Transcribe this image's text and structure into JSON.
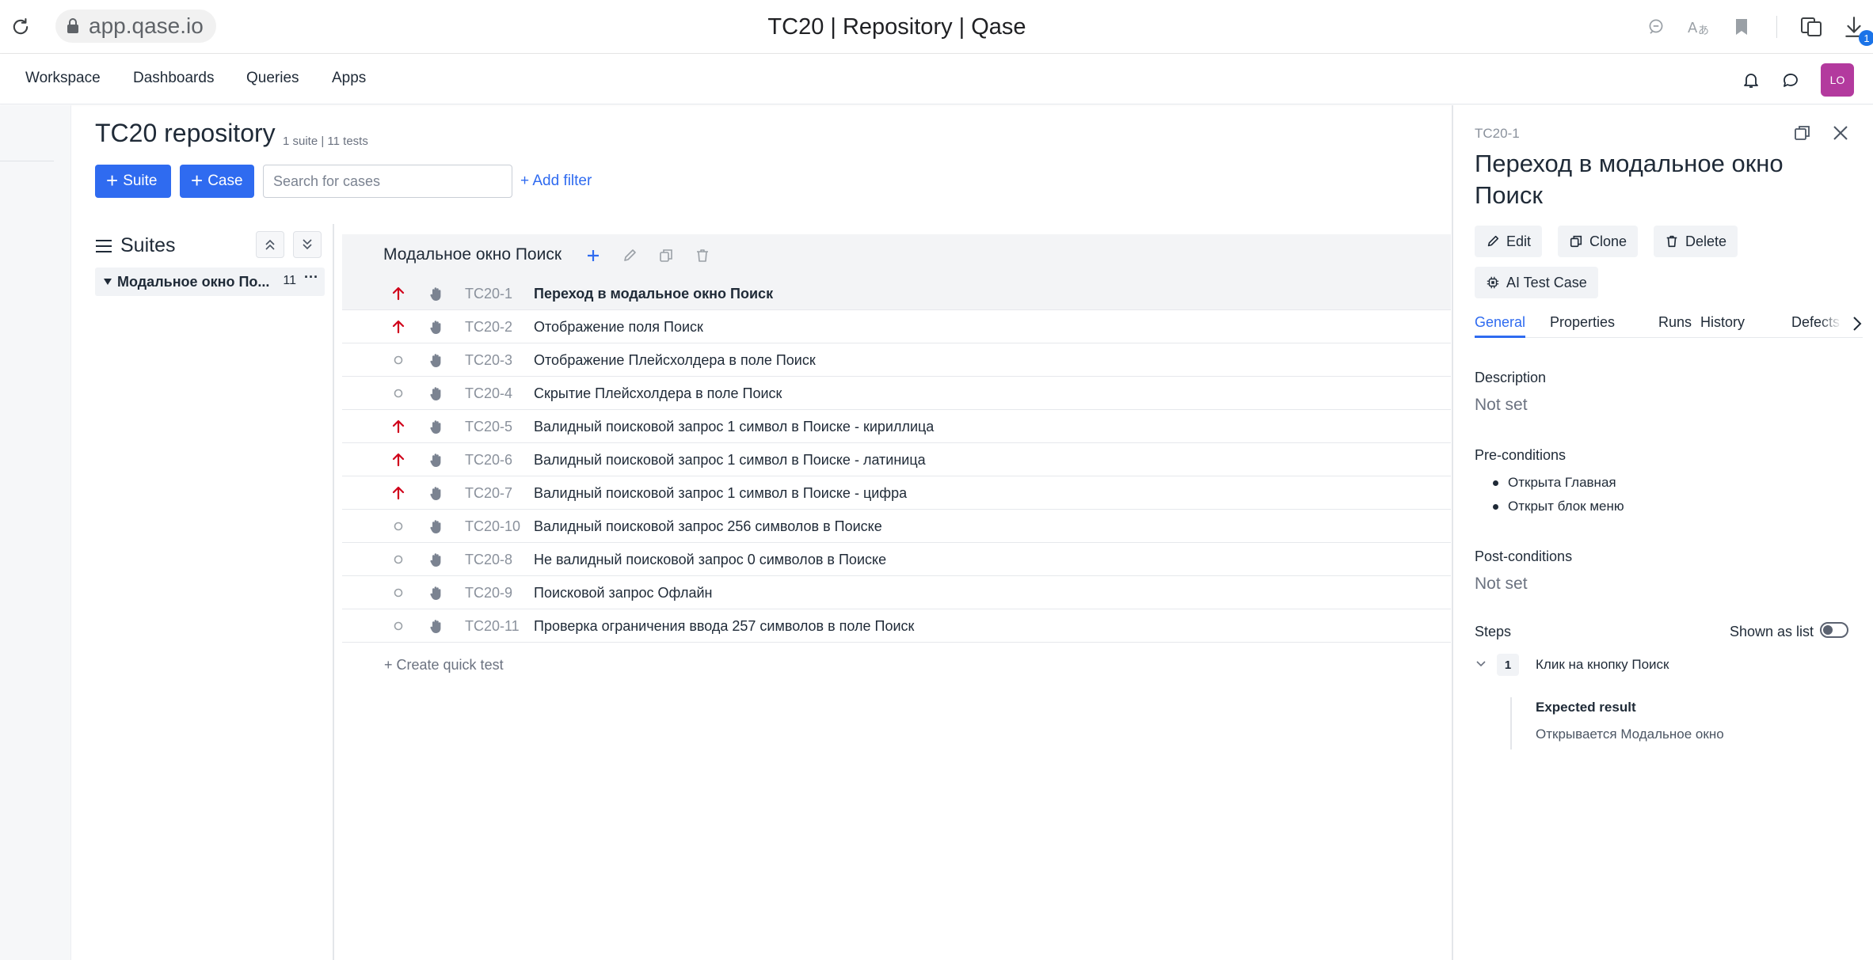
{
  "browser": {
    "url": "app.qase.io",
    "tab_title": "TC20 | Repository | Qase",
    "download_badge": "1"
  },
  "nav": {
    "items": [
      {
        "label": "Workspace"
      },
      {
        "label": "Dashboards"
      },
      {
        "label": "Queries"
      },
      {
        "label": "Apps"
      }
    ],
    "avatar_initials": "LO"
  },
  "header": {
    "title": "TC20 repository",
    "meta": "1 suite | 11 tests",
    "suite_button": "Suite",
    "case_button": "Case",
    "search_placeholder": "Search for cases",
    "add_filter": "+ Add filter"
  },
  "suites": {
    "title": "Suites",
    "items": [
      {
        "label": "Модальное окно По...",
        "count": "11",
        "more": "···"
      }
    ]
  },
  "suite_block": {
    "title": "Модальное окно Поиск"
  },
  "cases": [
    {
      "id": "TC20-1",
      "title": "Переход в модальное окно Поиск",
      "priority": "high",
      "selected": true
    },
    {
      "id": "TC20-2",
      "title": "Отображение поля Поиск",
      "priority": "high"
    },
    {
      "id": "TC20-3",
      "title": "Отображение Плейсхолдера в поле Поиск",
      "priority": "none"
    },
    {
      "id": "TC20-4",
      "title": "Скрытие Плейсхолдера в поле Поиск",
      "priority": "none"
    },
    {
      "id": "TC20-5",
      "title": "Валидный поисковой запрос 1 символ в Поиске - кириллица",
      "priority": "high"
    },
    {
      "id": "TC20-6",
      "title": "Валидный поисковой запрос 1 символ в Поиске - латиница",
      "priority": "high"
    },
    {
      "id": "TC20-7",
      "title": "Валидный поисковой запрос 1 символ в Поиске - цифра",
      "priority": "high"
    },
    {
      "id": "TC20-10",
      "title": "Валидный поисковой запрос 256 символов в Поиске",
      "priority": "none"
    },
    {
      "id": "TC20-8",
      "title": "Не валидный поисковой запрос 0 символов в Поиске",
      "priority": "none"
    },
    {
      "id": "TC20-9",
      "title": "Поисковой запрос Офлайн",
      "priority": "none"
    },
    {
      "id": "TC20-11",
      "title": "Проверка ограничения ввода 257 символов в поле Поиск",
      "priority": "none"
    }
  ],
  "quick_test": "+ Create quick test",
  "detail": {
    "id": "TC20-1",
    "title": "Переход в модальное окно Поиск",
    "buttons": {
      "edit": "Edit",
      "clone": "Clone",
      "delete": "Delete",
      "ai": "AI Test Case"
    },
    "tabs": [
      "General",
      "Properties",
      "Runs",
      "History",
      "Defects"
    ],
    "description_label": "Description",
    "description_value": "Not set",
    "preconditions_label": "Pre-conditions",
    "preconditions": [
      "Открыта Главная",
      "Открыт блок меню"
    ],
    "postconditions_label": "Post-conditions",
    "postconditions_value": "Not set",
    "steps_label": "Steps",
    "shown_as_list": "Shown as list",
    "steps": [
      {
        "number": "1",
        "action": "Клик на кнопку Поиск",
        "expected_label": "Expected result",
        "expected": "Открывается Модальное окно"
      }
    ]
  },
  "colors": {
    "primary": "#2f6bf0",
    "priority_high": "#d0021b",
    "avatar": "#b33a9e"
  }
}
